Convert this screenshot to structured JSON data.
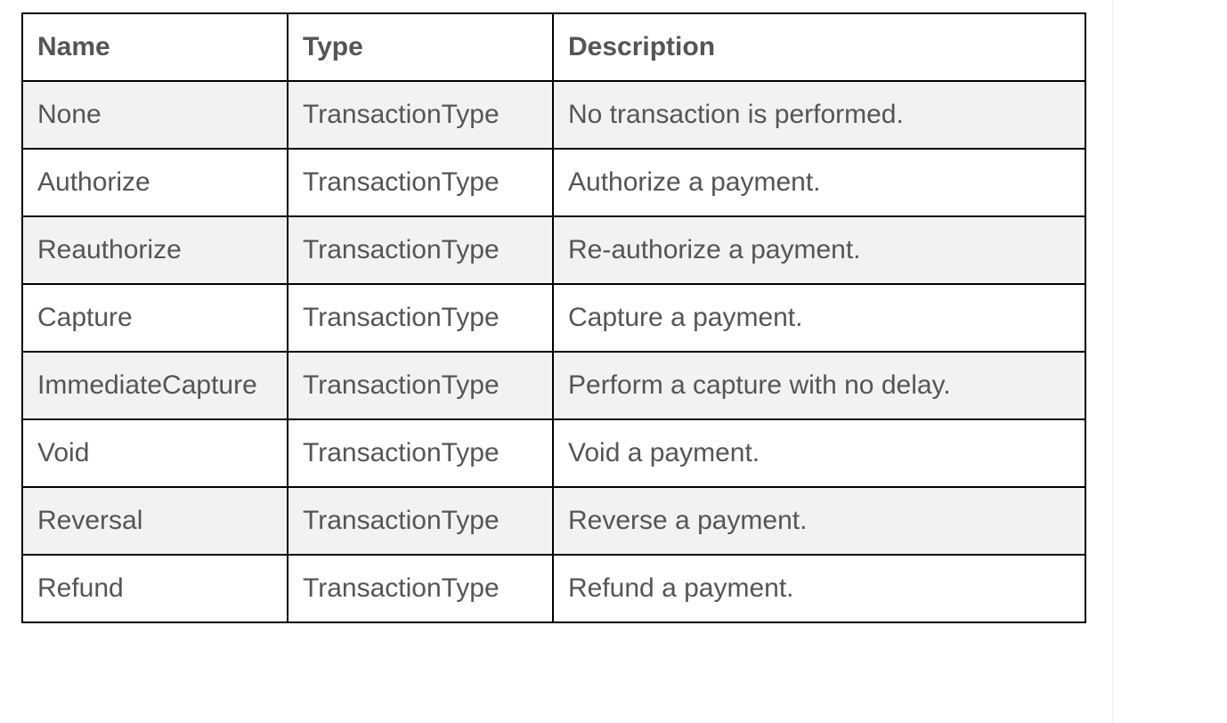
{
  "table": {
    "headers": {
      "name": "Name",
      "type": "Type",
      "description": "Description"
    },
    "rows": [
      {
        "name": "None",
        "type": "TransactionType",
        "description": "No transaction is performed."
      },
      {
        "name": "Authorize",
        "type": "TransactionType",
        "description": "Authorize a payment."
      },
      {
        "name": "Reauthorize",
        "type": "TransactionType",
        "description": "Re-authorize a payment."
      },
      {
        "name": "Capture",
        "type": "TransactionType",
        "description": "Capture a payment."
      },
      {
        "name": "ImmediateCapture",
        "type": "TransactionType",
        "description": "Perform a capture with no delay."
      },
      {
        "name": "Void",
        "type": "TransactionType",
        "description": "Void a payment."
      },
      {
        "name": "Reversal",
        "type": "TransactionType",
        "description": "Reverse a payment."
      },
      {
        "name": "Refund",
        "type": "TransactionType",
        "description": "Refund a payment."
      }
    ]
  },
  "colors": {
    "text": "#555555",
    "border": "#000000",
    "stripe": "#f2f2f2",
    "background": "#ffffff"
  }
}
